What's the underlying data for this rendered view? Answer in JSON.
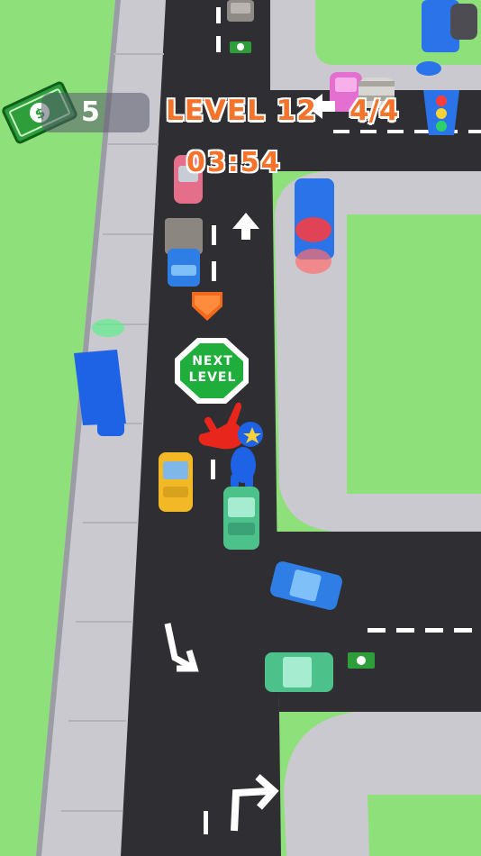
{
  "hud": {
    "money_count": "5",
    "level_label": "LEVEL 12",
    "progress": "4/4",
    "timer": "03:54"
  },
  "sign": {
    "line1": "NEXT",
    "line2": "LEVEL"
  },
  "colors": {
    "grass": "#8ee07a",
    "road": "#2f2f33",
    "sidewalk": "#c9c9cf",
    "hud_orange": "#f5732a",
    "sign_green": "#1fae3c",
    "police_blue": "#1e63e6"
  },
  "icons": [
    "cash-icon",
    "traffic-light-icon",
    "police-character",
    "red-hand-pointer"
  ]
}
